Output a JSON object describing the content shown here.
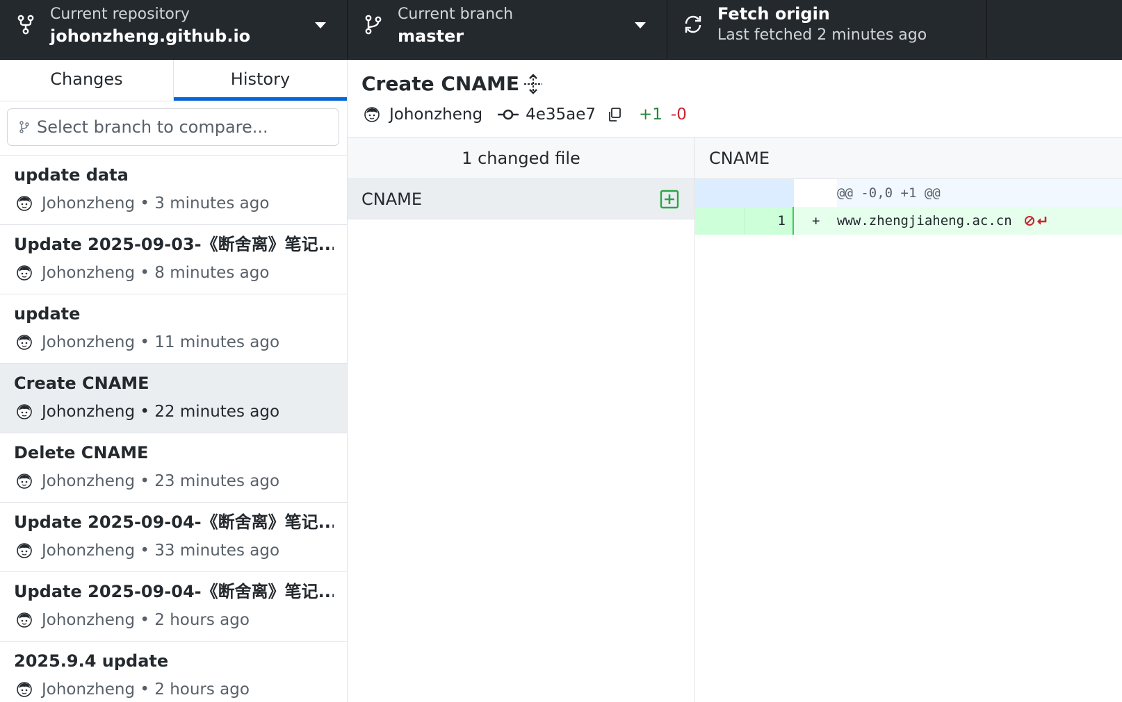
{
  "toolbar": {
    "repo": {
      "label": "Current repository",
      "value": "johonzheng.github.io"
    },
    "branch": {
      "label": "Current branch",
      "value": "master"
    },
    "fetch": {
      "title": "Fetch origin",
      "subtitle": "Last fetched 2 minutes ago"
    }
  },
  "sidebar": {
    "tabs": [
      {
        "label": "Changes"
      },
      {
        "label": "History"
      }
    ],
    "compare_placeholder": "Select branch to compare...",
    "commits": [
      {
        "title": "update data",
        "author": "Johonzheng",
        "time": "3 minutes ago"
      },
      {
        "title": "Update 2025-09-03-《断舍离》笔记....",
        "author": "Johonzheng",
        "time": "8 minutes ago"
      },
      {
        "title": "update",
        "author": "Johonzheng",
        "time": "11 minutes ago"
      },
      {
        "title": "Create CNAME",
        "author": "Johonzheng",
        "time": "22 minutes ago"
      },
      {
        "title": "Delete CNAME",
        "author": "Johonzheng",
        "time": "23 minutes ago"
      },
      {
        "title": "Update 2025-09-04-《断舍离》笔记....",
        "author": "Johonzheng",
        "time": "33 minutes ago"
      },
      {
        "title": "Update 2025-09-04-《断舍离》笔记....",
        "author": "Johonzheng",
        "time": "2 hours ago"
      },
      {
        "title": "2025.9.4 update",
        "author": "Johonzheng",
        "time": "2 hours ago"
      }
    ],
    "meta_separator": " • "
  },
  "commit_detail": {
    "title": "Create CNAME",
    "author": "Johonzheng",
    "sha": "4e35ae7",
    "additions": "+1",
    "deletions": "-0"
  },
  "files": {
    "header": "1 changed file",
    "items": [
      {
        "name": "CNAME",
        "status": "added"
      }
    ]
  },
  "diff": {
    "file": "CNAME",
    "hunk": "@@ -0,0 +1 @@",
    "lines": [
      {
        "new_line_no": "1",
        "sign": "+",
        "text": "www.zhengjiaheng.ac.cn"
      }
    ]
  },
  "colors": {
    "toolbar_bg": "#24292e",
    "accent": "#0366d6",
    "added": "#22863a",
    "deleted": "#cb2431"
  },
  "icons": [
    "repo-icon",
    "branch-icon",
    "sync-icon",
    "caret-down-icon",
    "git-branch-icon",
    "avatar-icon",
    "expand-icon",
    "commit-icon",
    "copy-icon",
    "file-added-icon",
    "no-newline-icon"
  ]
}
